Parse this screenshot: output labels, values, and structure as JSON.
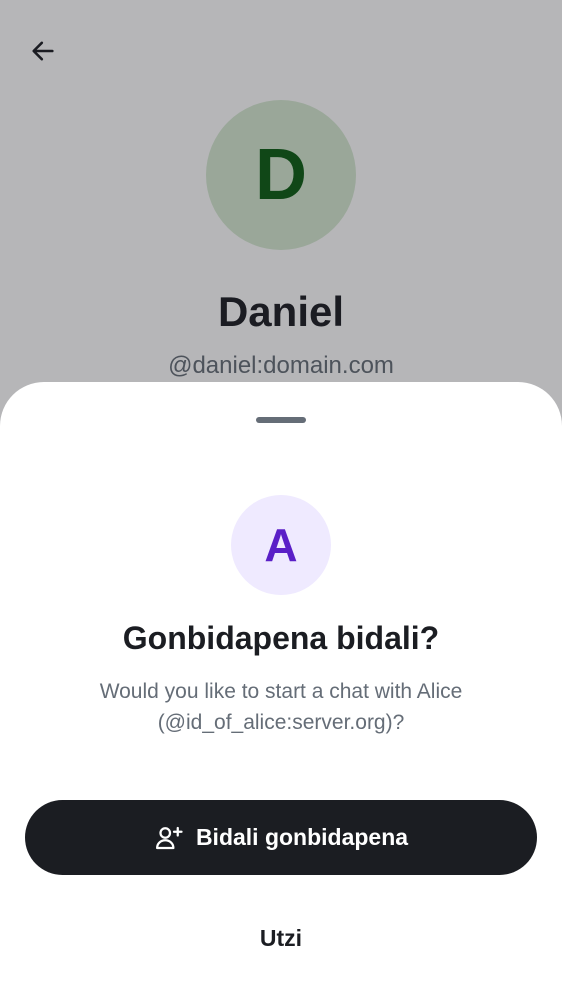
{
  "profile": {
    "avatar_letter": "D",
    "name": "Daniel",
    "user_id": "@daniel:domain.com",
    "back_icon": "arrow-left-icon"
  },
  "sheet": {
    "avatar_letter": "A",
    "title": "Gonbidapena bidali?",
    "message": "Would you like to start a chat with Alice (@id_of_alice:server.org)?",
    "primary_button": {
      "label": "Bidali gonbidapena",
      "icon": "user-add-icon"
    },
    "secondary_button": {
      "label": "Utzi"
    }
  },
  "colors": {
    "primary_button_bg": "#1b1d22",
    "profile_avatar_bg": "#d6e9d2",
    "profile_avatar_fg": "#0b5c13",
    "sheet_avatar_bg": "#efeaff",
    "sheet_avatar_fg": "#5a1fc7"
  }
}
